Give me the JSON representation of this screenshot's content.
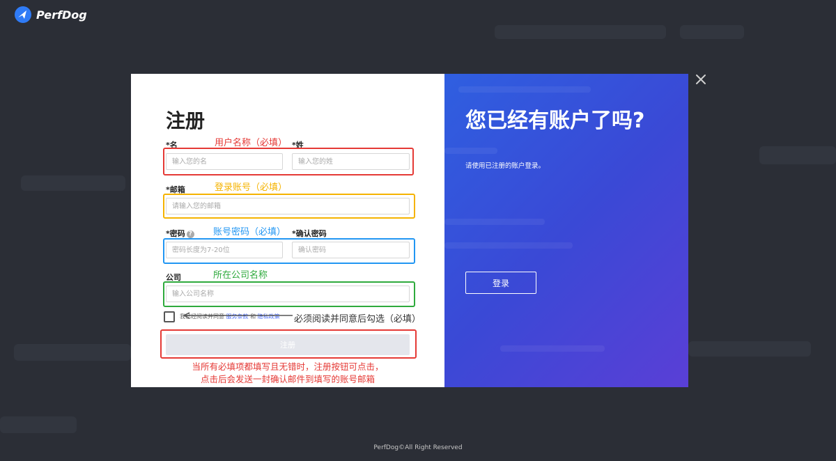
{
  "brand": {
    "name": "PerfDog"
  },
  "register": {
    "title": "注册",
    "first_name_label": "*名",
    "last_name_label": "*姓",
    "first_name_placeholder": "输入您的名",
    "last_name_placeholder": "输入您的姓",
    "email_label": "*邮箱",
    "email_placeholder": "请输入您的邮箱",
    "password_label": "*密码",
    "confirm_label": "*确认密码",
    "password_placeholder": "密码长度为7-20位",
    "confirm_placeholder": "确认密码",
    "company_label": "公司",
    "company_placeholder": "输入公司名称",
    "agree_text": "我已经阅读并同意",
    "agree_terms": "服务条款",
    "agree_and": "和",
    "agree_privacy": "隐私政策",
    "submit_label": "注册"
  },
  "annotations": {
    "name": "用户名称（必填）",
    "email": "登录账号（必填）",
    "password": "账号密码（必填）",
    "company": "所在公司名称",
    "agree": "必须阅读并同意后勾选（必填）",
    "note_line1": "当所有必填项都填写且无错时，注册按钮可点击，",
    "note_line2": "点击后会发送一封确认邮件到填写的账号邮箱"
  },
  "login": {
    "title": "您已经有账户了吗?",
    "subtitle": "请使用已注册的账户登录。",
    "button_label": "登录"
  },
  "footer": {
    "text": "PerfDog©All Right Reserved"
  },
  "colors": {
    "annotation_red": "#e53935",
    "annotation_yellow": "#f5b301",
    "annotation_blue": "#2196f3",
    "annotation_green": "#2eaa3c"
  },
  "icons": {
    "logo": "perfdog-logo-icon",
    "close": "close-icon",
    "help": "help-icon"
  }
}
